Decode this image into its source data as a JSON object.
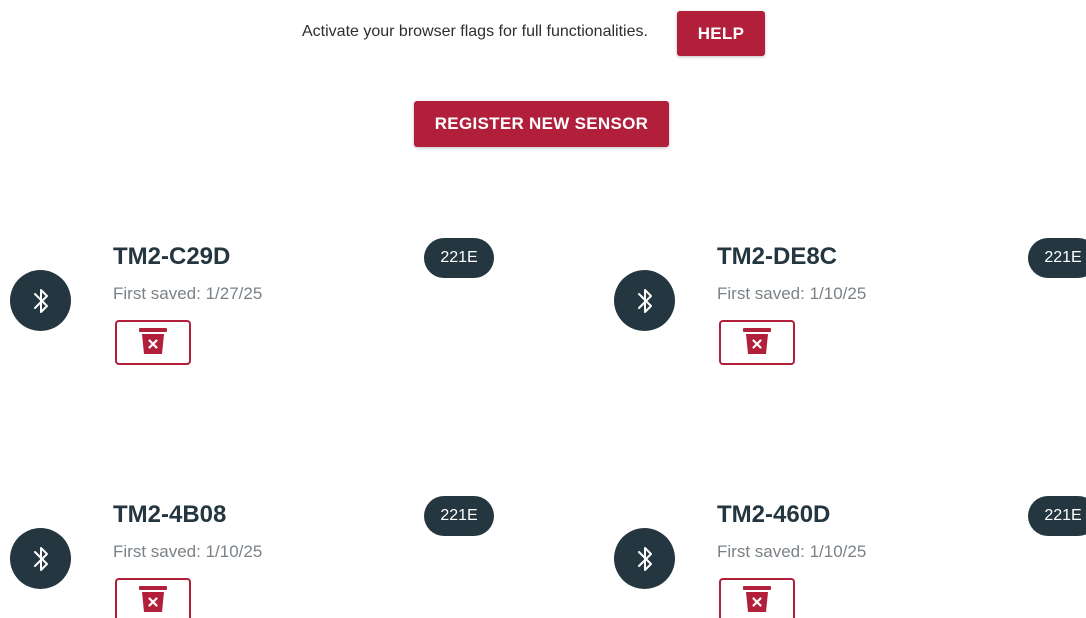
{
  "banner": {
    "text": "Activate your browser flags for full functionalities.",
    "help_label": "HELP"
  },
  "register_label": "REGISTER NEW SENSOR",
  "sensors": [
    {
      "name": "TM2-C29D",
      "first_saved": "First saved: 1/27/25",
      "badge": "221E"
    },
    {
      "name": "TM2-DE8C",
      "first_saved": "First saved: 1/10/25",
      "badge": "221E"
    },
    {
      "name": "TM2-4B08",
      "first_saved": "First saved: 1/10/25",
      "badge": "221E"
    },
    {
      "name": "TM2-460D",
      "first_saved": "First saved: 1/10/25",
      "badge": "221E"
    }
  ],
  "icons": {
    "bluetooth": "bluetooth-icon",
    "delete": "trash-icon"
  },
  "colors": {
    "accent": "#b21f3a",
    "dark": "#24363f",
    "muted": "#7b8287"
  }
}
